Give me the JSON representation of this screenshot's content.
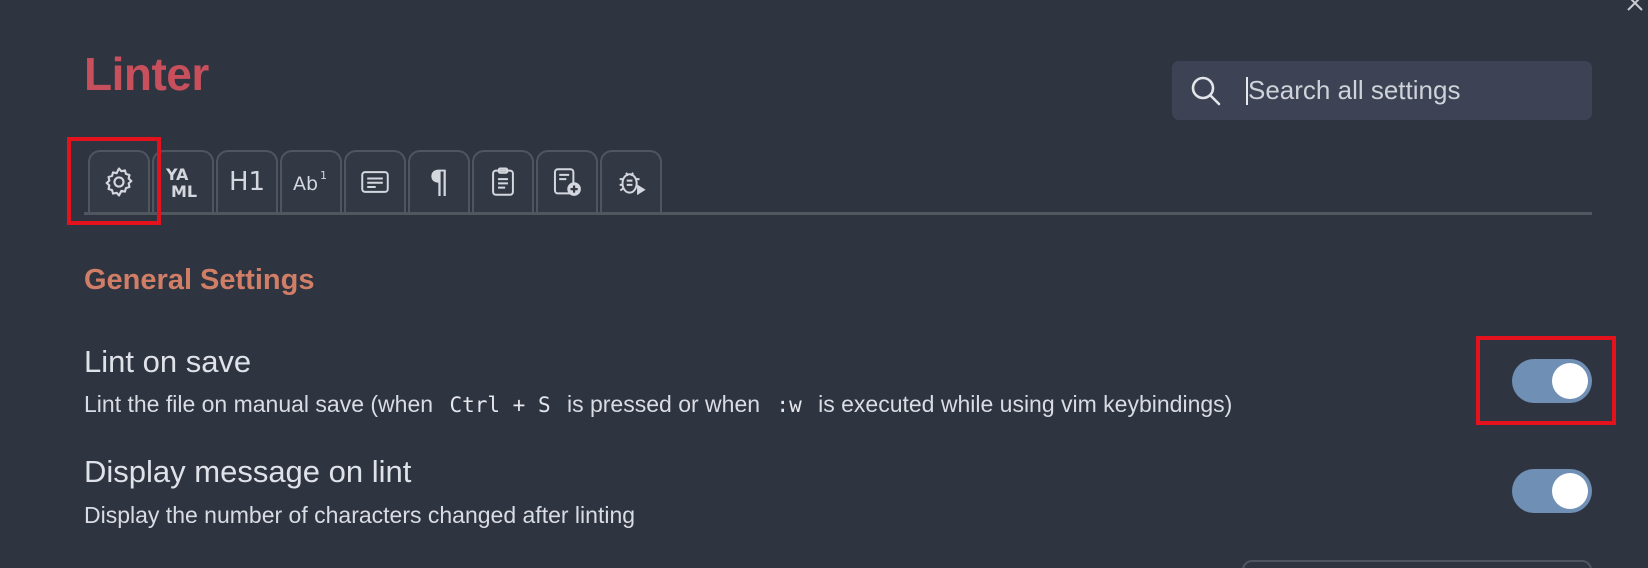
{
  "plugin": {
    "title": "Linter"
  },
  "search": {
    "placeholder": "Search all settings",
    "value": ""
  },
  "tabs": [
    {
      "icon": "gear-icon",
      "label": "",
      "active": true
    },
    {
      "icon": "yaml-icon",
      "label": "YA ML"
    },
    {
      "icon": "heading-icon",
      "label": "H1"
    },
    {
      "icon": "footnote-icon",
      "label": "Ab1"
    },
    {
      "icon": "content-icon",
      "label": ""
    },
    {
      "icon": "pilcrow-icon",
      "label": "¶"
    },
    {
      "icon": "clipboard-icon",
      "label": ""
    },
    {
      "icon": "custom-add-icon",
      "label": ""
    },
    {
      "icon": "debug-icon",
      "label": ""
    }
  ],
  "general": {
    "heading": "General Settings"
  },
  "settings": [
    {
      "name": "Lint on save",
      "desc_before": "Lint the file on manual save (when",
      "code1": "Ctrl + S",
      "desc_middle": "is pressed or when",
      "code2": ":w",
      "desc_after": "is executed while using vim keybindings)",
      "enabled": true
    },
    {
      "name": "Display message on lint",
      "desc": "Display the number of characters changed after linting",
      "enabled": true
    }
  ],
  "colors": {
    "background": "#2f3441",
    "title": "#c8505c",
    "section_heading": "#d17e67",
    "toggle_on": "#6f8fb4",
    "highlight": "#e4121c"
  }
}
